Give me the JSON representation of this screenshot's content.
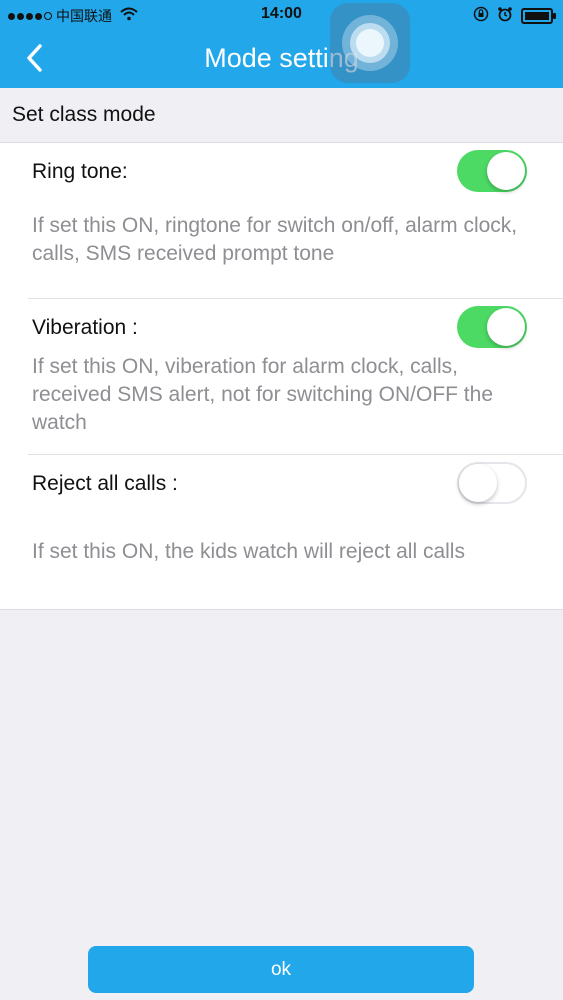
{
  "status_bar": {
    "carrier": "中国联通",
    "time": "14:00"
  },
  "nav": {
    "title": "Mode setting"
  },
  "section": {
    "title": "Set class mode"
  },
  "settings": [
    {
      "label": "Ring tone:",
      "enabled": true,
      "description": "If set this ON, ringtone for switch on/off, alarm clock, calls, SMS received prompt tone"
    },
    {
      "label": "Viberation :",
      "enabled": true,
      "description": "If set this ON, viberation for alarm clock, calls, received SMS alert, not for switching ON/OFF the watch"
    },
    {
      "label": "Reject all calls :",
      "enabled": false,
      "description": "If set this ON, the kids watch will reject all calls"
    }
  ],
  "footer": {
    "ok_label": "ok"
  },
  "colors": {
    "accent": "#21a7ea",
    "toggle_on": "#4cd964",
    "background": "#efeff4"
  },
  "icons": {
    "back": "chevron-left-icon",
    "wifi": "wifi-icon",
    "lock": "orientation-lock-icon",
    "alarm": "alarm-clock-icon",
    "battery": "battery-icon",
    "assistive": "assistive-touch-icon"
  }
}
